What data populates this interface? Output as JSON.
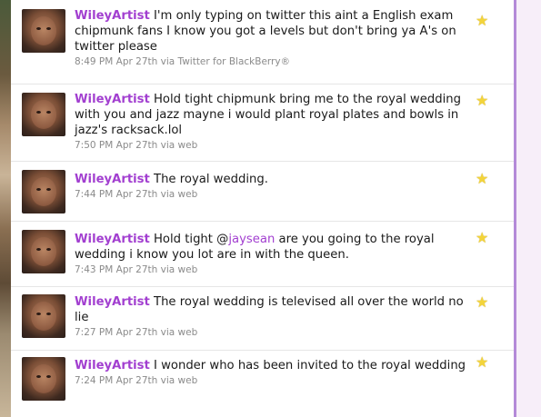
{
  "tweets": [
    {
      "user": "WileyArtist",
      "text_before": " I'm only typing on twitter this aint a English exam chipmunk fans I know you got a levels but don't bring ya A's on twitter please",
      "mention": "",
      "text_after": "",
      "time": "8:49 PM Apr 27th",
      "via": " via Twitter for BlackBerry®"
    },
    {
      "user": "WileyArtist",
      "text_before": " Hold tight chipmunk bring me to the royal wedding with you and jazz mayne i would plant royal plates and bowls in jazz's racksack.lol",
      "mention": "",
      "text_after": "",
      "time": "7:50 PM Apr 27th",
      "via": " via web"
    },
    {
      "user": "WileyArtist",
      "text_before": " The royal wedding.",
      "mention": "",
      "text_after": "",
      "time": "7:44 PM Apr 27th",
      "via": " via web"
    },
    {
      "user": "WileyArtist",
      "text_before": " Hold tight @",
      "mention": "jaysean",
      "text_after": " are you going to the royal wedding i know you lot are in with the queen.",
      "time": "7:43 PM Apr 27th",
      "via": " via web"
    },
    {
      "user": "WileyArtist",
      "text_before": " The royal wedding is televised all over the world no lie",
      "mention": "",
      "text_after": "",
      "time": "7:27 PM Apr 27th",
      "via": " via web"
    },
    {
      "user": "WileyArtist",
      "text_before": " I wonder who has been invited to the royal wedding",
      "mention": "",
      "text_after": "",
      "time": "7:24 PM Apr 27th",
      "via": " via web"
    }
  ],
  "icons": {
    "favorite": "star-icon",
    "avatar": "user-avatar"
  },
  "colors": {
    "username": "#a23fd0",
    "meta": "#8a8a8a",
    "star": "#f3d43a",
    "sidebar_border": "#b48ad8"
  }
}
